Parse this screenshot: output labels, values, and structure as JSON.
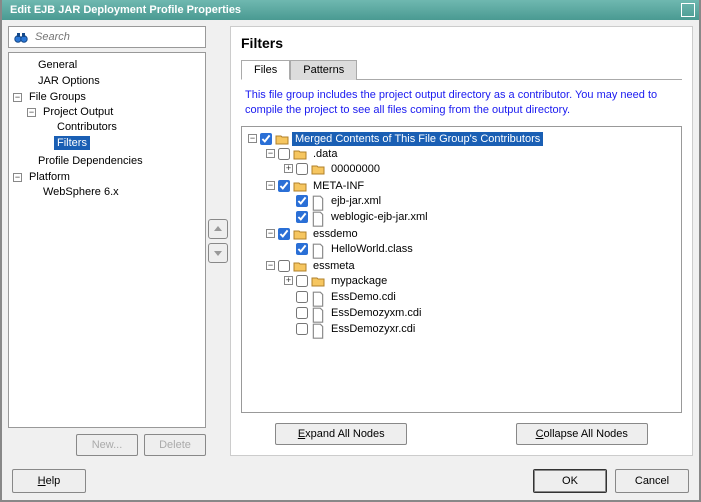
{
  "title": "Edit EJB JAR Deployment Profile Properties",
  "search": {
    "placeholder": "Search"
  },
  "nav": {
    "general": "General",
    "jar_options": "JAR Options",
    "file_groups": "File Groups",
    "project_output": "Project Output",
    "contributors": "Contributors",
    "filters": "Filters",
    "profile_dependencies": "Profile Dependencies",
    "platform": "Platform",
    "websphere": "WebSphere 6.x"
  },
  "left_buttons": {
    "new": "New...",
    "delete": "Delete"
  },
  "panel": {
    "heading": "Filters",
    "tab_files": "Files",
    "tab_patterns": "Patterns",
    "info": "This file group includes the project output directory as a contributor.  You may need to compile the project to see all files coming from the output directory.",
    "root": "Merged Contents of This File Group's Contributors",
    "nodes": {
      "data": ".data",
      "zeros": "00000000",
      "metainf": "META-INF",
      "ejbjar": "ejb-jar.xml",
      "weblogic": "weblogic-ejb-jar.xml",
      "essdemo": "essdemo",
      "helloworld": "HelloWorld.class",
      "essmeta": "essmeta",
      "mypackage": "mypackage",
      "essdemocdi": "EssDemo.cdi",
      "essdemozyxm": "EssDemozyxm.cdi",
      "essdemozyxr": "EssDemozyxr.cdi"
    },
    "expand_prefix": "E",
    "expand_rest": "xpand All Nodes",
    "collapse_prefix": "C",
    "collapse_rest": "ollapse All Nodes"
  },
  "footer": {
    "help_prefix": "H",
    "help_rest": "elp",
    "ok": "OK",
    "cancel": "Cancel"
  }
}
